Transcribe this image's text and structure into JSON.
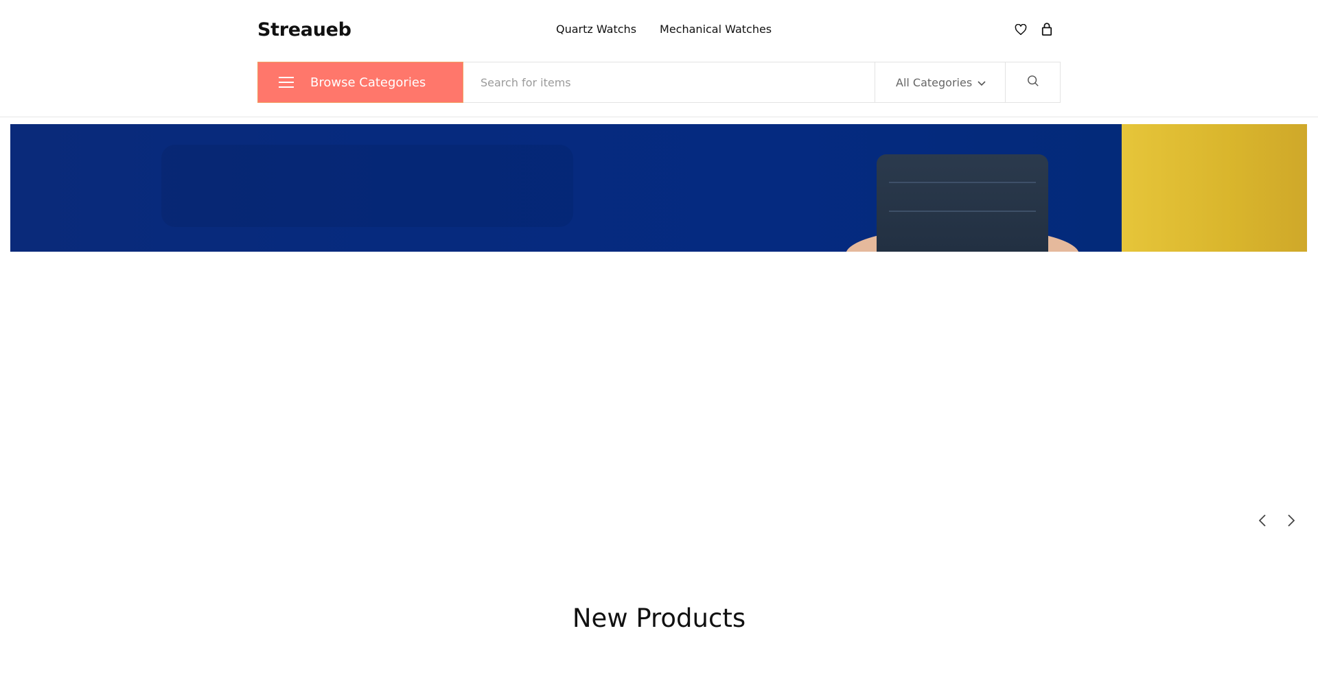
{
  "header": {
    "logo": "Streaueb",
    "nav": [
      "Quartz Watchs",
      "Mechanical Watches"
    ],
    "icons": [
      "heart-icon",
      "shopping-bag-icon"
    ]
  },
  "search": {
    "browse_label": "Browse Categories",
    "placeholder": "Search for items",
    "category_selected": "All Categories",
    "accent_color": "#ff776b"
  },
  "hero": {
    "background_color": "#062a7e",
    "accent_color": "#d9b52c"
  },
  "slider": {
    "prev_icon": "chevron-left-icon",
    "next_icon": "chevron-right-icon"
  },
  "sections": {
    "new_products_title": "New Products"
  }
}
